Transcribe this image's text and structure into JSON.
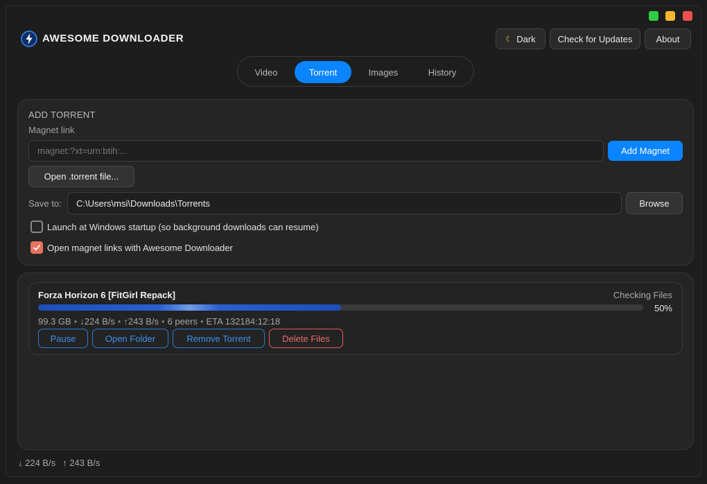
{
  "app": {
    "title": "AWESOME DOWNLOADER",
    "accent_color": "#0a84ff",
    "logo_icon": "lightning-bolt-icon"
  },
  "window_controls": [
    "maximize",
    "minimize",
    "close"
  ],
  "header": {
    "theme_label": "Dark",
    "theme_icon": "moon-icon",
    "updates_label": "Check for Updates",
    "about_label": "About"
  },
  "tabs": [
    {
      "label": "Video",
      "active": false
    },
    {
      "label": "Torrent",
      "active": true
    },
    {
      "label": "Images",
      "active": false
    },
    {
      "label": "History",
      "active": false
    }
  ],
  "add_torrent": {
    "section_title": "ADD TORRENT",
    "magnet_label": "Magnet link",
    "magnet_placeholder": "magnet:?xt=urn:btih:...",
    "add_magnet_label": "Add Magnet",
    "open_file_label": "Open .torrent file...",
    "save_to_label": "Save to:",
    "save_path": "C:\\Users\\msi\\Downloads\\Torrents",
    "browse_label": "Browse",
    "options": [
      {
        "label": "Launch at Windows startup (so background downloads can resume)",
        "checked": false
      },
      {
        "label": "Open magnet links with Awesome Downloader",
        "checked": true
      }
    ]
  },
  "torrents": [
    {
      "name": "Forza Horizon 6 [FitGirl Repack]",
      "status": "Checking Files",
      "progress_percent": 50,
      "progress_label": "50%",
      "size": "99.3 GB",
      "down_speed": "↓224 B/s",
      "up_speed": "↑243 B/s",
      "peers": "6 peers",
      "eta": "ETA 132184:12:18",
      "actions": {
        "pause": "Pause",
        "open_folder": "Open Folder",
        "remove": "Remove Torrent",
        "delete": "Delete Files"
      }
    }
  ],
  "footer": {
    "down_total": "↓ 224 B/s",
    "up_total": "↑ 243 B/s"
  }
}
